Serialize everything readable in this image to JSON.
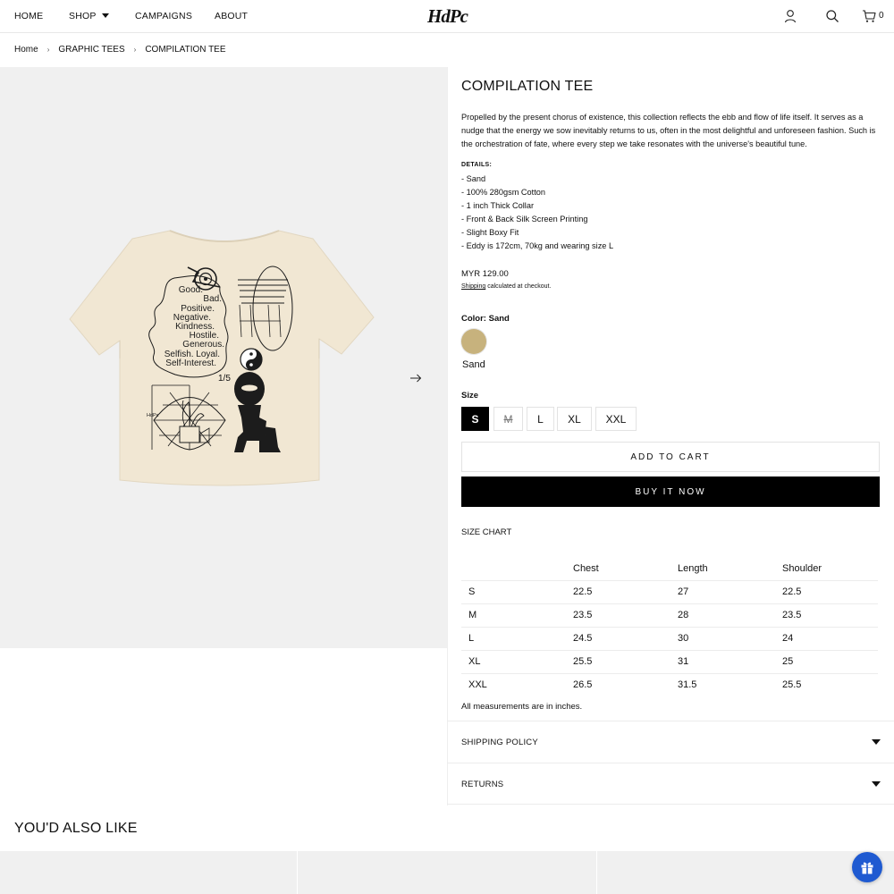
{
  "header": {
    "nav": {
      "home": "HOME",
      "shop": "SHOP",
      "campaigns": "CAMPAIGNS",
      "about": "ABOUT"
    },
    "logo": "HdPc",
    "cart_count": "0",
    "icons": [
      "account-icon",
      "search-icon",
      "cart-icon"
    ]
  },
  "breadcrumb": {
    "home": "Home",
    "category": "GRAPHIC TEES",
    "current": "COMPILATION TEE"
  },
  "gallery": {
    "counter": "1/5",
    "product_image": {
      "text_lines": [
        "Good.",
        "Bad.",
        "Positive.",
        "Negative.",
        "Kindness.",
        "Hostile.",
        "Generous.",
        "Selfish. Loyal.",
        "Self-Interest."
      ],
      "small_text_left": "HdPc",
      "shirt_color": "#f1e7d3"
    }
  },
  "product": {
    "title": "COMPILATION TEE",
    "description": "Propelled by the present chorus of existence, this collection reflects the ebb and flow of life itself. It serves as a nudge that the energy we sow inevitably returns to us, often in the most delightful and unforeseen fashion. Such is the orchestration of fate, where every step we take resonates with the universe's beautiful tune.",
    "details_label": "DETAILS:",
    "details": [
      "- Sand",
      "- 100% 280gsm Cotton",
      "- 1 inch Thick Collar",
      "- Front & Back Silk Screen Printing",
      "- Slight Boxy Fit",
      "- Eddy is 172cm, 70kg and wearing size L"
    ],
    "price": "MYR 129.00",
    "shipping_link": "Shipping",
    "shipping_rest": " calculated at checkout.",
    "color_label": "Color: Sand",
    "swatch_label": "Sand",
    "swatch_color": "#c7b27d",
    "size_label": "Size",
    "sizes": [
      "S",
      "M",
      "L",
      "XL",
      "XXL"
    ],
    "selected_size": "S",
    "soldout_size": "M",
    "add_to_cart": "ADD TO CART",
    "buy_now": "BUY IT NOW"
  },
  "size_chart": {
    "title": "SIZE CHART",
    "headers": [
      "",
      "Chest",
      "Length",
      "Shoulder"
    ],
    "rows": [
      [
        "S",
        "22.5",
        "27",
        "22.5"
      ],
      [
        "M",
        "23.5",
        "28",
        "23.5"
      ],
      [
        "L",
        "24.5",
        "30",
        "24"
      ],
      [
        "XL",
        "25.5",
        "31",
        "25"
      ],
      [
        "XXL",
        "26.5",
        "31.5",
        "25.5"
      ]
    ],
    "note": "All measurements are in inches."
  },
  "accordions": {
    "shipping": "SHIPPING POLICY",
    "returns": "RETURNS"
  },
  "also_like": "YOU'D ALSO LIKE",
  "colors": {
    "gift_button": "#1f5ad1",
    "gallery_bg": "#f0f0f0"
  }
}
